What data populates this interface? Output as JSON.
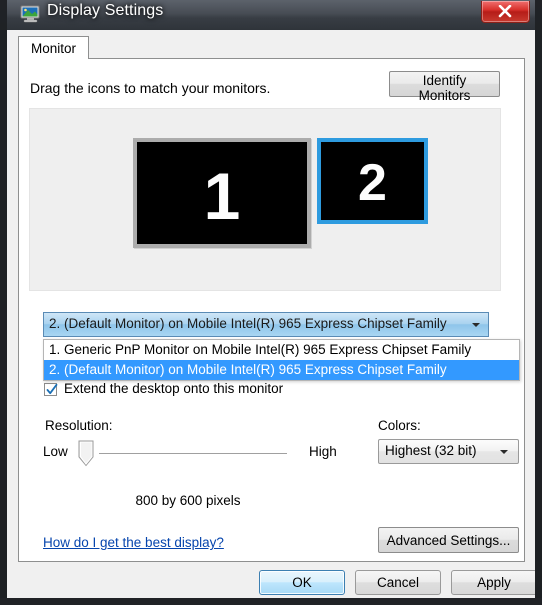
{
  "window": {
    "title": "Display Settings",
    "icon": "display-monitor-icon",
    "close_label": "close-icon"
  },
  "tabs": [
    {
      "label": "Monitor",
      "active": true
    }
  ],
  "page": {
    "instruction": "Drag the icons to match your monitors.",
    "identify_button": "Identify Monitors"
  },
  "monitors": [
    {
      "number": "1",
      "selected": false
    },
    {
      "number": "2",
      "selected": true
    }
  ],
  "monitor_select": {
    "value": "2. (Default Monitor) on Mobile Intel(R) 965 Express Chipset Family",
    "expanded": true,
    "options": [
      {
        "label": "1. Generic PnP Monitor on Mobile Intel(R) 965 Express Chipset Family",
        "selected": false
      },
      {
        "label": "2. (Default Monitor) on Mobile Intel(R) 965 Express Chipset Family",
        "selected": true
      }
    ]
  },
  "extend_desktop": {
    "label": "Extend the desktop onto this monitor",
    "checked": true
  },
  "resolution": {
    "label": "Resolution:",
    "low_label": "Low",
    "high_label": "High",
    "readout": "800 by 600 pixels",
    "slider_percent": 10
  },
  "colors": {
    "label": "Colors:",
    "value": "Highest (32 bit)"
  },
  "help_link": "How do I get the best display?",
  "advanced_button": "Advanced Settings...",
  "footer": {
    "ok": "OK",
    "cancel": "Cancel",
    "apply": "Apply"
  },
  "theme": {
    "selection_blue": "#3399ff",
    "monitor_selected_border": "#2e9bdf",
    "monitor_border": "#acacac",
    "link_color": "#0645ad",
    "close_red": "#d8312b"
  }
}
